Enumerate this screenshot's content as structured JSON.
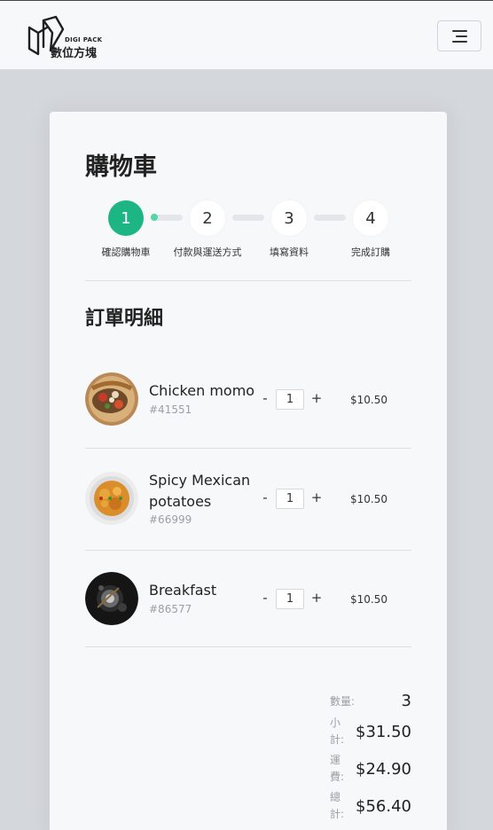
{
  "brand": {
    "name_en": "DIGI PACK",
    "name_zh": "數位方塊"
  },
  "page": {
    "title": "購物車"
  },
  "steps": [
    {
      "number": "1",
      "label": "確認購物車",
      "active": true
    },
    {
      "number": "2",
      "label": "付款與運送方式",
      "active": false
    },
    {
      "number": "3",
      "label": "填寫資料",
      "active": false
    },
    {
      "number": "4",
      "label": "完成訂購",
      "active": false
    }
  ],
  "order": {
    "section_title": "訂單明細",
    "items": [
      {
        "name": "Chicken momo",
        "id": "#41551",
        "quantity": "1",
        "price": "$10.50",
        "minus": "-",
        "plus": "+"
      },
      {
        "name": "Spicy Mexican potatoes",
        "id": "#66999",
        "quantity": "1",
        "price": "$10.50",
        "minus": "-",
        "plus": "+"
      },
      {
        "name": "Breakfast",
        "id": "#86577",
        "quantity": "1",
        "price": "$10.50",
        "minus": "-",
        "plus": "+"
      }
    ]
  },
  "summary": {
    "quantity_label": "數量:",
    "quantity_value": "3",
    "subtotal_label": "小計:",
    "subtotal_value": "$31.50",
    "shipping_label": "運費:",
    "shipping_value": "$24.90",
    "total_label": "總計:",
    "total_value": "$56.40"
  },
  "colors": {
    "accent": "#1db584",
    "progress_dot": "#55d6a5",
    "page_background": "#d4d7dc",
    "card_background": "#f7f8fa"
  },
  "icons": {
    "logo": "digipack-logo-icon",
    "menu": "hamburger-menu-icon"
  }
}
